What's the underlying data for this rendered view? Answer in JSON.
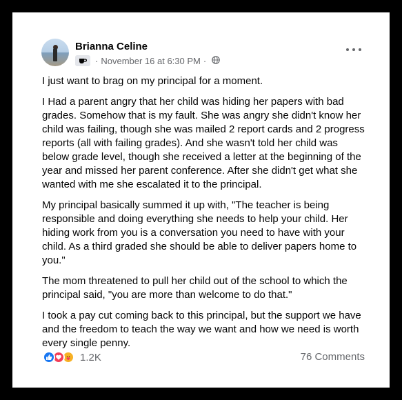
{
  "post": {
    "author": "Brianna Celine",
    "timestamp": "November 16 at 6:30 PM",
    "separator": "·",
    "badge_icon": "coffee-cup-icon",
    "audience_icon": "globe-icon",
    "more_icon": "more-horizontal-icon",
    "paragraphs": [
      "I just want to brag on my principal for a moment.",
      "I Had a parent angry that her child was hiding her papers with bad grades. Somehow that is my fault. She was angry she didn't know her child was failing, though she was mailed 2 report cards and 2 progress reports (all with failing grades). And she wasn't told her child was below grade level, though she received a letter at the beginning of the year and missed her parent conference. After she didn't get what she wanted with me she escalated it to the principal.",
      "My principal basically summed it up with, \"The teacher is being responsible and doing everything she needs to help your child. Her hiding work from you is a conversation you need to have with your child. As a third graded she should be able to deliver papers home to you.\"",
      "The mom threatened to pull her child out of the school to which the principal said, \"you are more than welcome to do that.\"",
      "I took a pay cut coming back to this principal, but the support we have and the freedom to teach the way we want and how we need is worth every single penny."
    ]
  },
  "footer": {
    "reaction_icons": [
      "like-icon",
      "love-icon",
      "care-icon"
    ],
    "reaction_count": "1.2K",
    "comments_label": "76 Comments"
  },
  "colors": {
    "background": "#000000",
    "card": "#ffffff",
    "text": "#050505",
    "secondary_text": "#65676b",
    "like_blue": "#1877f2",
    "love_red": "#f33e58",
    "care_yellow": "#f7b125"
  }
}
